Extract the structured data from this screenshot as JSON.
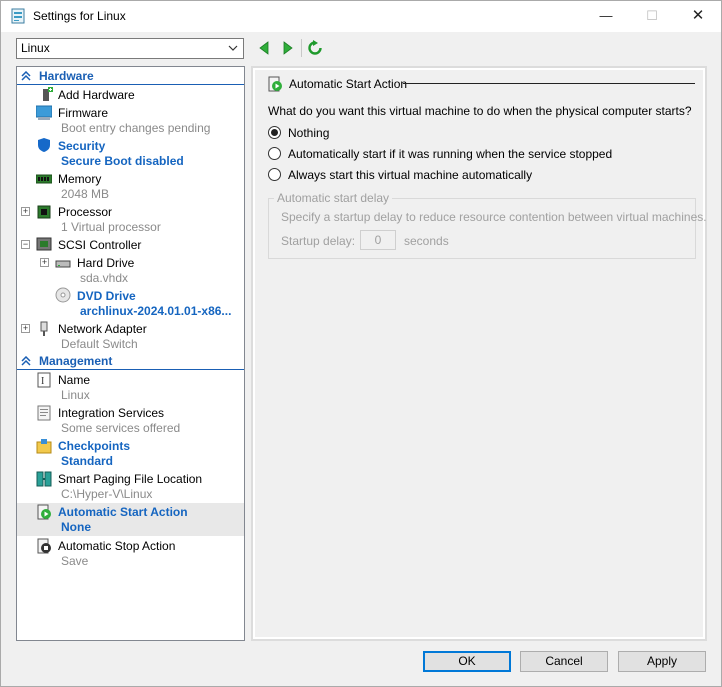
{
  "window": {
    "title": "Settings for Linux",
    "controls": {
      "minimize": "—",
      "maximize": "☐",
      "close": "✕"
    }
  },
  "toolbar": {
    "vm_selected": "Linux",
    "back_icon": "back-arrow-icon",
    "forward_icon": "forward-arrow-icon",
    "refresh_icon": "refresh-icon"
  },
  "hardware": {
    "header": "Hardware",
    "items": [
      {
        "label": "Add Hardware",
        "sub": ""
      },
      {
        "label": "Firmware",
        "sub": "Boot entry changes pending"
      },
      {
        "label": "Security",
        "sub": "Secure Boot disabled"
      },
      {
        "label": "Memory",
        "sub": "2048 MB"
      },
      {
        "label": "Processor",
        "sub": "1 Virtual processor"
      },
      {
        "label": "SCSI Controller",
        "sub": ""
      },
      {
        "label": "Hard Drive",
        "sub": "sda.vhdx"
      },
      {
        "label": "DVD Drive",
        "sub": "archlinux-2024.01.01-x86..."
      },
      {
        "label": "Network Adapter",
        "sub": "Default Switch"
      }
    ]
  },
  "management": {
    "header": "Management",
    "items": [
      {
        "label": "Name",
        "sub": "Linux"
      },
      {
        "label": "Integration Services",
        "sub": "Some services offered"
      },
      {
        "label": "Checkpoints",
        "sub": "Standard"
      },
      {
        "label": "Smart Paging File Location",
        "sub": "C:\\Hyper-V\\Linux"
      },
      {
        "label": "Automatic Start Action",
        "sub": "None"
      },
      {
        "label": "Automatic Stop Action",
        "sub": "Save"
      }
    ]
  },
  "panel": {
    "title": "Automatic Start Action",
    "question": "What do you want this virtual machine to do when the physical computer starts?",
    "options": [
      {
        "label": "Nothing",
        "checked": true
      },
      {
        "label": "Automatically start if it was running when the service stopped",
        "checked": false
      },
      {
        "label": "Always start this virtual machine automatically",
        "checked": false
      }
    ],
    "delay_group": {
      "legend": "Automatic start delay",
      "description": "Specify a startup delay to reduce resource contention between virtual machines.",
      "label": "Startup delay:",
      "value": "0",
      "unit": "seconds"
    }
  },
  "buttons": {
    "ok": "OK",
    "cancel": "Cancel",
    "apply": "Apply"
  },
  "colors": {
    "accent": "#1565c0",
    "header_blue": "#1a5fb4",
    "selection": "#e8e8e8",
    "default_border": "#0078d7"
  }
}
